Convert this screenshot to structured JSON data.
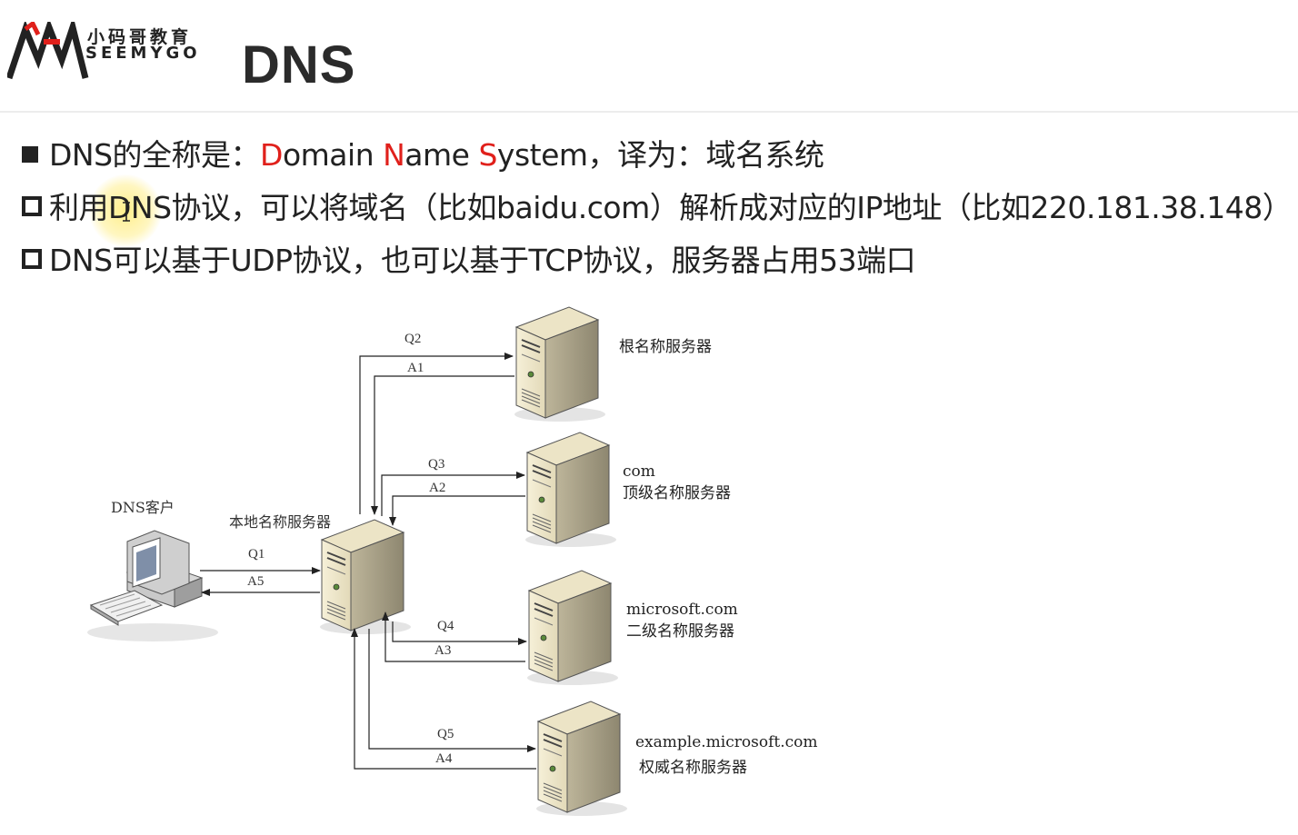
{
  "header": {
    "logo_cn": "小码哥教育",
    "logo_en": "SEEMYGO",
    "title": "DNS"
  },
  "bullets": [
    {
      "prefix": "DNS的全称是：",
      "d_letter": "D",
      "d_rest": "omain ",
      "n_letter": "N",
      "n_rest": "ame ",
      "s_letter": "S",
      "s_rest": "ystem",
      "suffix": "，译为：域名系统"
    },
    {
      "text": "利用DNS协议，可以将域名（比如baidu.com）解析成对应的IP地址（比如220.181.38.148）"
    },
    {
      "text": "DNS可以基于UDP协议，也可以基于TCP协议，服务器占用53端口"
    }
  ],
  "diagram": {
    "client_label": "DNS客户",
    "local_server_label": "本地名称服务器",
    "servers": [
      {
        "name": "根名称服务器",
        "domain": ""
      },
      {
        "name": "顶级名称服务器",
        "domain": "com"
      },
      {
        "name": "二级名称服务器",
        "domain": "microsoft.com"
      },
      {
        "name": "权威名称服务器",
        "domain": "example.microsoft.com"
      }
    ],
    "arrows": {
      "q1": "Q1",
      "a5": "A5",
      "q2": "Q2",
      "a1": "A1",
      "q3": "Q3",
      "a2": "A2",
      "q4": "Q4",
      "a3": "A3",
      "q5": "Q5",
      "a4": "A4"
    }
  },
  "colors": {
    "accent": "#e0201b",
    "text": "#222222"
  }
}
